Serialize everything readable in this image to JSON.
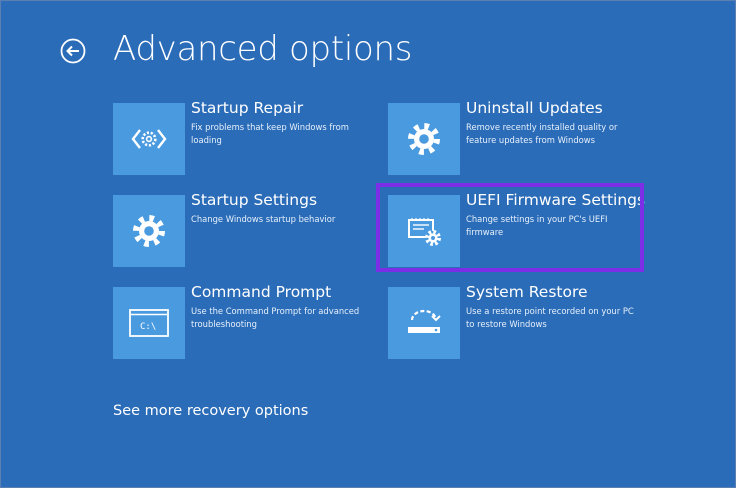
{
  "page": {
    "title": "Advanced options",
    "back_icon": "arrow-left-circle-icon",
    "background_color": "#2b6cb8",
    "tile_color": "#4a9ae0",
    "highlight_color": "#7b2ee6"
  },
  "options": [
    {
      "title": "Startup Repair",
      "description": "Fix problems that keep Windows from loading",
      "icon": "code-brackets-gear-icon"
    },
    {
      "title": "Uninstall Updates",
      "description": "Remove recently installed quality or feature updates from Windows",
      "icon": "gear-icon"
    },
    {
      "title": "Startup Settings",
      "description": "Change Windows startup behavior",
      "icon": "gear-icon"
    },
    {
      "title": "UEFI Firmware Settings",
      "description": "Change settings in your PC's UEFI firmware",
      "icon": "chip-gear-icon",
      "highlighted": true
    },
    {
      "title": "Command Prompt",
      "description": "Use the Command Prompt for advanced troubleshooting",
      "icon": "command-prompt-icon",
      "icon_text": "C:\\"
    },
    {
      "title": "System Restore",
      "description": "Use a restore point recorded on your PC to restore Windows",
      "icon": "restore-icon"
    }
  ],
  "footer": {
    "see_more": "See more recovery options"
  }
}
